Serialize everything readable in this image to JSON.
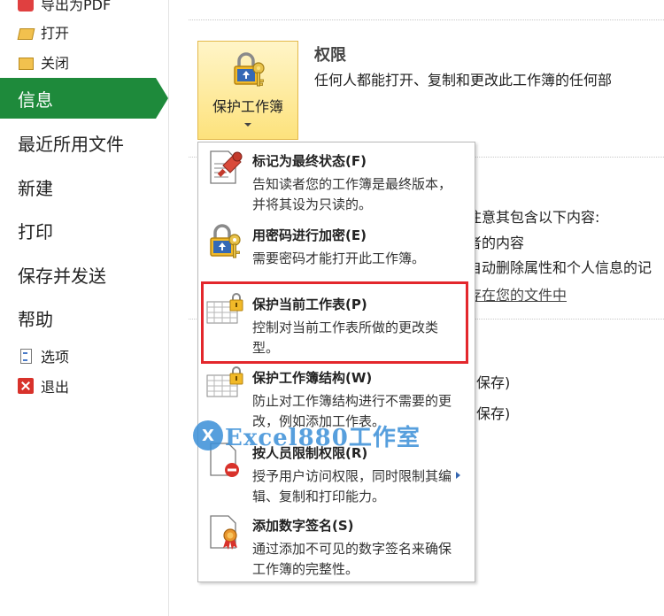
{
  "nav": {
    "top_items": [
      {
        "label": "导出为PDF",
        "icon": "pdf-icon"
      },
      {
        "label": "打开",
        "icon": "folder-open-icon"
      },
      {
        "label": "关闭",
        "icon": "folder-icon"
      }
    ],
    "main_items": [
      {
        "label": "信息",
        "active": true
      },
      {
        "label": "最近所用文件",
        "active": false
      },
      {
        "label": "新建",
        "active": false
      },
      {
        "label": "打印",
        "active": false
      },
      {
        "label": "保存并发送",
        "active": false
      },
      {
        "label": "帮助",
        "active": false
      }
    ],
    "bottom_items": [
      {
        "label": "选项",
        "icon": "options-icon"
      },
      {
        "label": "退出",
        "icon": "exit-icon"
      }
    ],
    "active_color": "#1e8a3b"
  },
  "protect_button": {
    "label": "保护工作簿",
    "icon": "lock-key-icon"
  },
  "permissions": {
    "title": "权限",
    "description": "任何人都能打开、复制和更改此工作簿的任何部"
  },
  "background_text": {
    "line1": "注意其包含以下内容:",
    "line2": "者的内容",
    "line3": "自动删除属性和个人信息的记",
    "line4": "存在您的文件中",
    "line5": "保存)",
    "line6": "保存)"
  },
  "menu": {
    "items": [
      {
        "title": "标记为最终状态(F)",
        "description": "告知读者您的工作簿是最终版本，并将其设为只读的。",
        "icon": "mark-final-icon"
      },
      {
        "title": "用密码进行加密(E)",
        "description": "需要密码才能打开此工作簿。",
        "icon": "encrypt-password-icon"
      },
      {
        "title": "保护当前工作表(P)",
        "description": "控制对当前工作表所做的更改类型。",
        "icon": "protect-sheet-icon"
      },
      {
        "title": "保护工作簿结构(W)",
        "description": "防止对工作簿结构进行不需要的更改，例如添加工作表。",
        "icon": "protect-structure-icon"
      },
      {
        "title": "按人员限制权限(R)",
        "description": "授予用户访问权限，同时限制其编辑、复制和打印能力。",
        "icon": "restrict-permission-icon"
      },
      {
        "title": "添加数字签名(S)",
        "description": "通过添加不可见的数字签名来确保工作簿的完整性。",
        "icon": "digital-signature-icon"
      }
    ],
    "highlight_color": "#e3272c"
  },
  "watermark": {
    "logo_text": "X",
    "text": "Excel880工作室"
  }
}
